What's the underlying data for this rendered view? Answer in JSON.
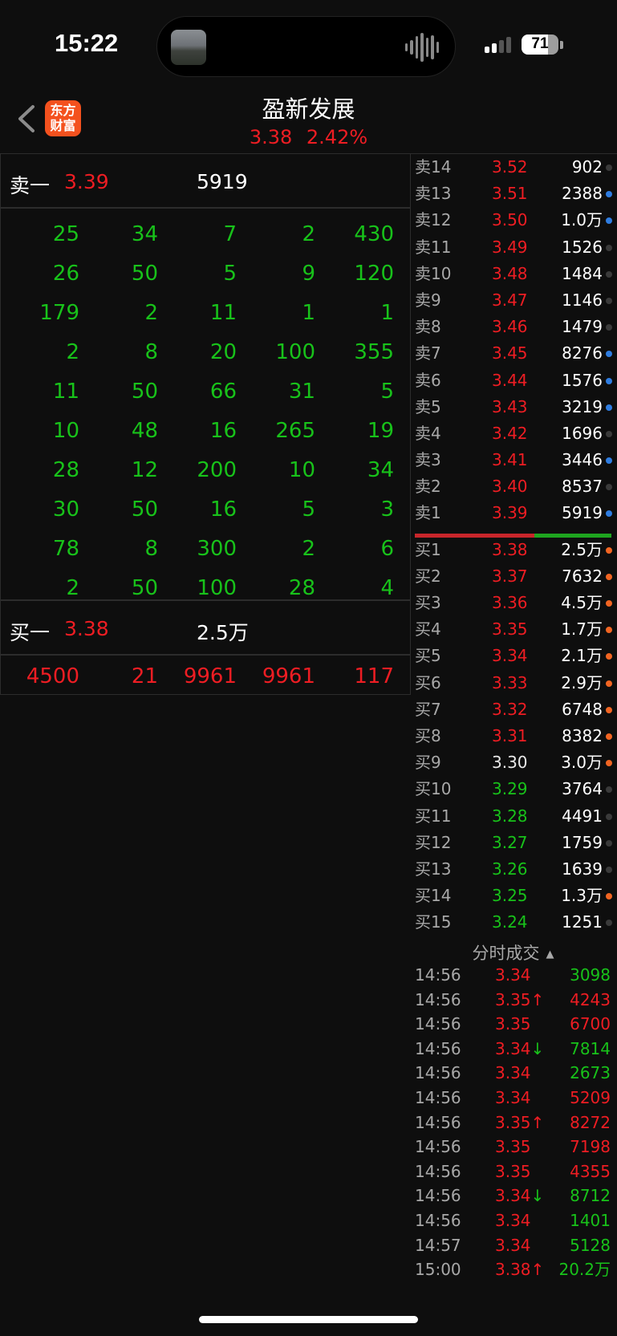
{
  "status": {
    "time": "15:22",
    "battery": "71",
    "battery_fraction": 0.71
  },
  "header": {
    "title": "盈新发展",
    "price": "3.38",
    "change_pct": "2.42%",
    "logo_text": "东方财富"
  },
  "level1": {
    "sell": {
      "label": "卖一",
      "price": "3.39",
      "volume": "5919"
    },
    "buy": {
      "label": "买一",
      "price": "3.38",
      "volume": "2.5万"
    }
  },
  "sell_queue": [
    [
      "25",
      "34",
      "7",
      "2",
      "430"
    ],
    [
      "26",
      "50",
      "5",
      "9",
      "120"
    ],
    [
      "179",
      "2",
      "11",
      "1",
      "1"
    ],
    [
      "2",
      "8",
      "20",
      "100",
      "355"
    ],
    [
      "11",
      "50",
      "66",
      "31",
      "5"
    ],
    [
      "10",
      "48",
      "16",
      "265",
      "19"
    ],
    [
      "28",
      "12",
      "200",
      "10",
      "34"
    ],
    [
      "30",
      "50",
      "16",
      "5",
      "3"
    ],
    [
      "78",
      "8",
      "300",
      "2",
      "6"
    ],
    [
      "2",
      "50",
      "100",
      "28",
      "4"
    ]
  ],
  "buy_queue": [
    [
      "4500",
      "21",
      "9961",
      "9961",
      "117"
    ]
  ],
  "order_book": {
    "asks": [
      {
        "label": "卖14",
        "price": "3.52",
        "volume": "902",
        "dot": "gray"
      },
      {
        "label": "卖13",
        "price": "3.51",
        "volume": "2388",
        "dot": "blue"
      },
      {
        "label": "卖12",
        "price": "3.50",
        "volume": "1.0万",
        "dot": "blue"
      },
      {
        "label": "卖11",
        "price": "3.49",
        "volume": "1526",
        "dot": "gray"
      },
      {
        "label": "卖10",
        "price": "3.48",
        "volume": "1484",
        "dot": "gray"
      },
      {
        "label": "卖9",
        "price": "3.47",
        "volume": "1146",
        "dot": "gray"
      },
      {
        "label": "卖8",
        "price": "3.46",
        "volume": "1479",
        "dot": "gray"
      },
      {
        "label": "卖7",
        "price": "3.45",
        "volume": "8276",
        "dot": "blue"
      },
      {
        "label": "卖6",
        "price": "3.44",
        "volume": "1576",
        "dot": "blue"
      },
      {
        "label": "卖5",
        "price": "3.43",
        "volume": "3219",
        "dot": "blue"
      },
      {
        "label": "卖4",
        "price": "3.42",
        "volume": "1696",
        "dot": "gray"
      },
      {
        "label": "卖3",
        "price": "3.41",
        "volume": "3446",
        "dot": "blue"
      },
      {
        "label": "卖2",
        "price": "3.40",
        "volume": "8537",
        "dot": "gray"
      },
      {
        "label": "卖1",
        "price": "3.39",
        "volume": "5919",
        "dot": "blue"
      }
    ],
    "bids": [
      {
        "label": "买1",
        "price": "3.38",
        "volume": "2.5万",
        "dot": "orange",
        "color": "red"
      },
      {
        "label": "买2",
        "price": "3.37",
        "volume": "7632",
        "dot": "orange",
        "color": "red"
      },
      {
        "label": "买3",
        "price": "3.36",
        "volume": "4.5万",
        "dot": "orange",
        "color": "red"
      },
      {
        "label": "买4",
        "price": "3.35",
        "volume": "1.7万",
        "dot": "orange",
        "color": "red"
      },
      {
        "label": "买5",
        "price": "3.34",
        "volume": "2.1万",
        "dot": "orange",
        "color": "red"
      },
      {
        "label": "买6",
        "price": "3.33",
        "volume": "2.9万",
        "dot": "orange",
        "color": "red"
      },
      {
        "label": "买7",
        "price": "3.32",
        "volume": "6748",
        "dot": "orange",
        "color": "red"
      },
      {
        "label": "买8",
        "price": "3.31",
        "volume": "8382",
        "dot": "orange",
        "color": "red"
      },
      {
        "label": "买9",
        "price": "3.30",
        "volume": "3.0万",
        "dot": "orange",
        "color": "white"
      },
      {
        "label": "买10",
        "price": "3.29",
        "volume": "3764",
        "dot": "gray",
        "color": "green"
      },
      {
        "label": "买11",
        "price": "3.28",
        "volume": "4491",
        "dot": "gray",
        "color": "green"
      },
      {
        "label": "买12",
        "price": "3.27",
        "volume": "1759",
        "dot": "gray",
        "color": "green"
      },
      {
        "label": "买13",
        "price": "3.26",
        "volume": "1639",
        "dot": "gray",
        "color": "green"
      },
      {
        "label": "买14",
        "price": "3.25",
        "volume": "1.3万",
        "dot": "orange",
        "color": "green"
      },
      {
        "label": "买15",
        "price": "3.24",
        "volume": "1251",
        "dot": "gray",
        "color": "green"
      }
    ],
    "ratio_red": 0.61
  },
  "trades": {
    "title": "分时成交",
    "rows": [
      {
        "time": "14:56",
        "price": "3.34",
        "arrow": "",
        "volume": "3098",
        "vcolor": "green"
      },
      {
        "time": "14:56",
        "price": "3.35",
        "arrow": "up",
        "volume": "4243",
        "vcolor": "red"
      },
      {
        "time": "14:56",
        "price": "3.35",
        "arrow": "",
        "volume": "6700",
        "vcolor": "red"
      },
      {
        "time": "14:56",
        "price": "3.34",
        "arrow": "down",
        "volume": "7814",
        "vcolor": "green"
      },
      {
        "time": "14:56",
        "price": "3.34",
        "arrow": "",
        "volume": "2673",
        "vcolor": "green"
      },
      {
        "time": "14:56",
        "price": "3.34",
        "arrow": "",
        "volume": "5209",
        "vcolor": "red"
      },
      {
        "time": "14:56",
        "price": "3.35",
        "arrow": "up",
        "volume": "8272",
        "vcolor": "red"
      },
      {
        "time": "14:56",
        "price": "3.35",
        "arrow": "",
        "volume": "7198",
        "vcolor": "red"
      },
      {
        "time": "14:56",
        "price": "3.35",
        "arrow": "",
        "volume": "4355",
        "vcolor": "red"
      },
      {
        "time": "14:56",
        "price": "3.34",
        "arrow": "down",
        "volume": "8712",
        "vcolor": "green"
      },
      {
        "time": "14:56",
        "price": "3.34",
        "arrow": "",
        "volume": "1401",
        "vcolor": "green"
      },
      {
        "time": "14:57",
        "price": "3.34",
        "arrow": "",
        "volume": "5128",
        "vcolor": "green"
      },
      {
        "time": "15:00",
        "price": "3.38",
        "arrow": "up",
        "volume": "20.2万",
        "vcolor": "green"
      }
    ]
  },
  "colors": {
    "red": "#ee1d23",
    "green": "#18c21a",
    "blue": "#2f7de1",
    "orange": "#f26522",
    "gray": "#3a3a3a",
    "white": "#e8e8e8"
  }
}
